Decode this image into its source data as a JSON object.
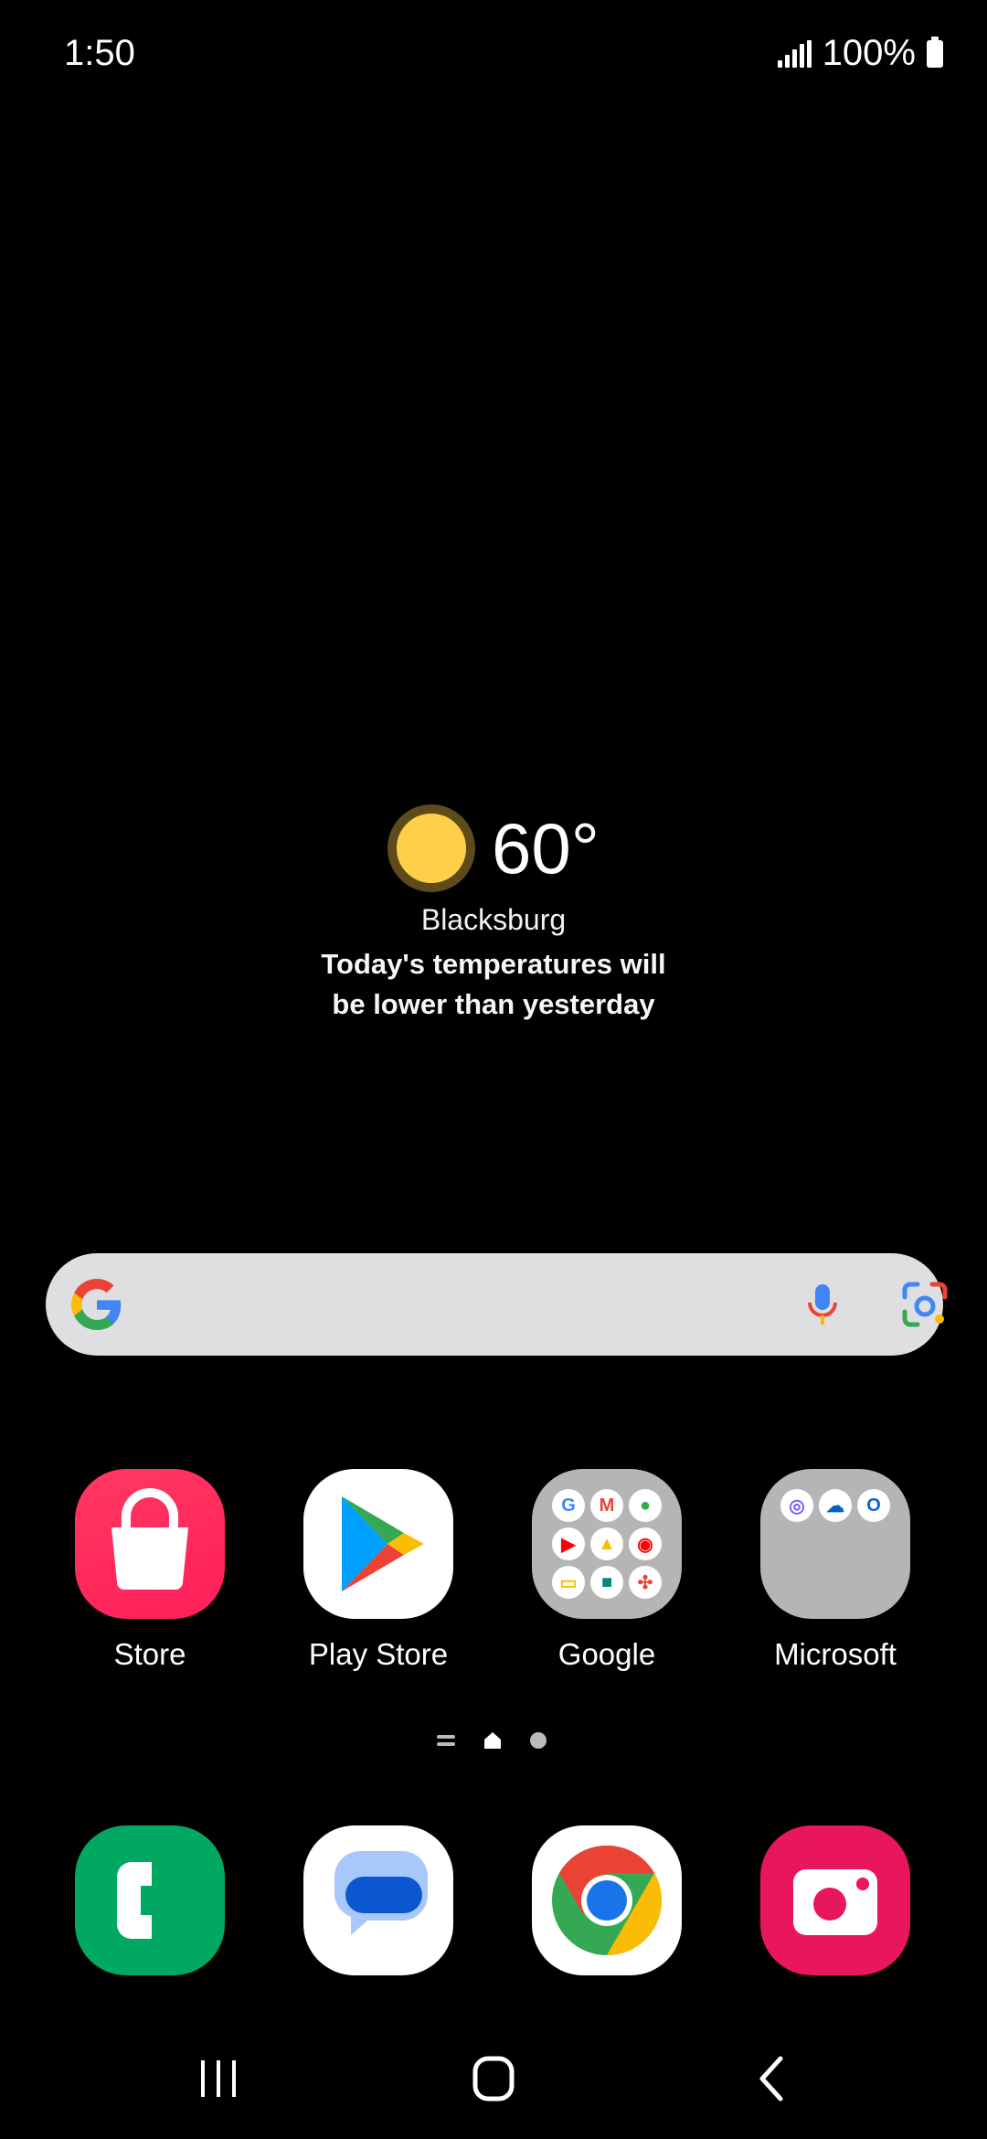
{
  "status_bar": {
    "time": "1:50",
    "battery": "100%"
  },
  "weather": {
    "temperature": "60°",
    "city": "Blacksburg",
    "message_line1": "Today's temperatures will",
    "message_line2": "be lower than yesterday"
  },
  "search": {
    "icons": [
      "google-g-icon",
      "mic-icon",
      "google-lens-icon"
    ]
  },
  "apps": [
    {
      "label": "Store",
      "icon": "galaxy-store-icon"
    },
    {
      "label": "Play Store",
      "icon": "play-store-icon"
    },
    {
      "label": "Google",
      "icon": "google-folder-icon"
    },
    {
      "label": "Microsoft",
      "icon": "microsoft-folder-icon"
    }
  ],
  "dock": [
    {
      "icon": "phone-icon"
    },
    {
      "icon": "messages-icon"
    },
    {
      "icon": "chrome-icon"
    },
    {
      "icon": "camera-icon"
    }
  ],
  "nav": {
    "icons": [
      "recents-icon",
      "home-icon",
      "back-icon"
    ]
  },
  "colors": {
    "background": "#000000",
    "search_bar": "#dfdfe1",
    "store": "#ff2a5c",
    "phone": "#00a862",
    "camera": "#e8155f",
    "sun": "#ffcf4a"
  }
}
